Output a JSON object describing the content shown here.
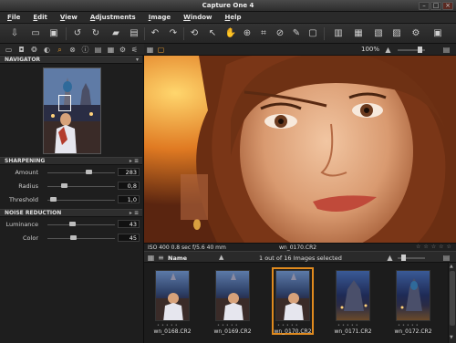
{
  "window": {
    "title": "Capture One 4"
  },
  "menu": [
    "File",
    "Edit",
    "View",
    "Adjustments",
    "Image",
    "Window",
    "Help"
  ],
  "viewer": {
    "zoom": "100%",
    "info": "ISO 400  0.8 sec  f/5.6  40 mm",
    "filename": "wn_0170.CR2"
  },
  "panels": {
    "navigator": "NAVIGATOR",
    "sharpening": {
      "title": "SHARPENING",
      "rows": [
        {
          "label": "Amount",
          "value": "283",
          "level": 0.62
        },
        {
          "label": "Radius",
          "value": "0,8",
          "level": 0.22
        },
        {
          "label": "Threshold",
          "value": "1,0",
          "level": 0.05
        }
      ]
    },
    "noise": {
      "title": "NOISE REDUCTION",
      "rows": [
        {
          "label": "Luminance",
          "value": "43",
          "level": 0.36
        },
        {
          "label": "Color",
          "value": "45",
          "level": 0.38
        }
      ]
    }
  },
  "browser": {
    "sort_label": "Name",
    "selection": "1 out of 16 Images selected",
    "thumbs": [
      {
        "name": "wn_0168.CR2"
      },
      {
        "name": "wn_0169.CR2"
      },
      {
        "name": "wn_0170.CR2"
      },
      {
        "name": "wn_0171.CR2"
      },
      {
        "name": "wn_0172.CR2"
      }
    ]
  },
  "colors": {
    "accent": "#e08a1e",
    "panel": "#1e1e1e"
  },
  "icons": {
    "toolbar": [
      "import-icon",
      "capture-icon",
      "camera-icon",
      "rotate-left-icon",
      "rotate-right-icon",
      "folder-icon",
      "trash-icon",
      "undo-icon",
      "redo-icon",
      "reset-icon",
      "select-icon",
      "pan-icon",
      "zoom-icon",
      "crop-icon",
      "straighten-icon",
      "picker-icon",
      "annotate-icon",
      "process-icon",
      "batch-icon",
      "export-icon",
      "print-icon",
      "settings-icon",
      "fullscreen-icon"
    ]
  }
}
